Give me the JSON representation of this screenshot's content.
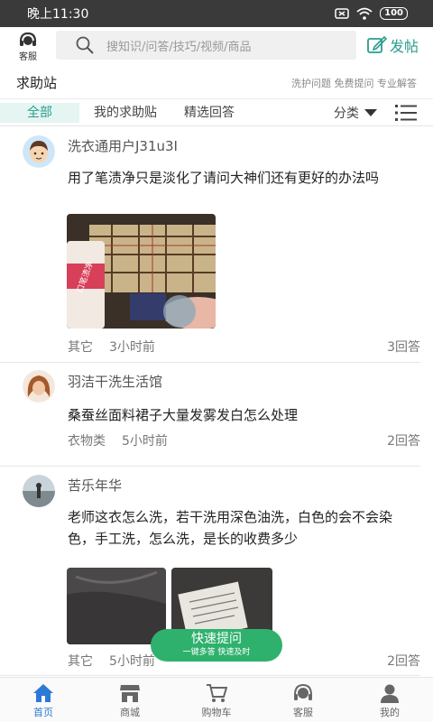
{
  "status": {
    "time": "晚上11:30",
    "battery": "100"
  },
  "top": {
    "cs_label": "客服",
    "search_placeholder": "搜知识/问答/技巧/视频/商品",
    "post_label": "发帖"
  },
  "help": {
    "title": "求助站",
    "subtitle": "洗护问题 免费提问 专业解答"
  },
  "tabs": [
    "全部",
    "我的求助贴",
    "精选回答"
  ],
  "sort_label": "分类",
  "posts": [
    {
      "user": "洗衣通用户J31u3I",
      "question": "用了笔渍净只是淡化了请问大神们还有更好的办法吗",
      "category": "其它",
      "time": "3小时前",
      "answers": "3回答",
      "image_text": "口笔渍净"
    },
    {
      "user": "羽洁干洗生活馆",
      "question": "桑蚕丝面料裙子大量发雾发白怎么处理",
      "category": "衣物类",
      "time": "5小时前",
      "answers": "2回答"
    },
    {
      "user": "苦乐年华",
      "question": "老师这衣怎么洗，若干洗用深色油洗，白色的会不会染色，手工洗，怎么洗，是长的收费多少",
      "category": "其它",
      "time": "5小时前",
      "answers": "2回答"
    }
  ],
  "fab": {
    "main": "快速提问",
    "sub": "一键多答 快速及时"
  },
  "nav": [
    "首页",
    "商城",
    "购物车",
    "客服",
    "我的"
  ],
  "colors": {
    "accent": "#2a9d8f",
    "fab": "#2fb16e",
    "nav_active": "#2c7ad6"
  }
}
